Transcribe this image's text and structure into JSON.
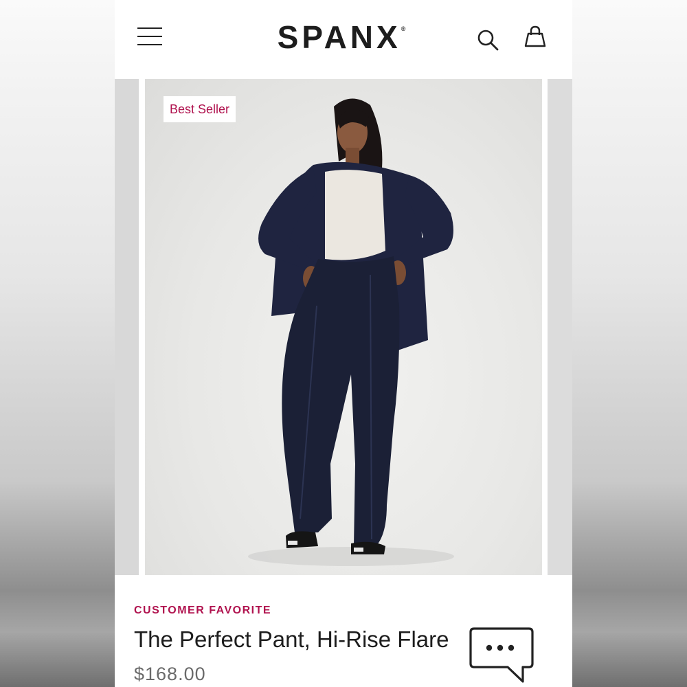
{
  "header": {
    "logo_text": "SPANX",
    "logo_mark": "®",
    "menu_icon": "hamburger-menu-icon",
    "search_icon": "search-icon",
    "bag_icon": "shopping-bag-icon"
  },
  "product": {
    "badge": "Best Seller",
    "eyebrow": "CUSTOMER FAVORITE",
    "name": "The Perfect Pant, Hi-Rise Flare",
    "price": "$168.00",
    "image_alt": "Model wearing navy blazer and navy flare pants"
  },
  "chat": {
    "icon": "chat-bubble-icon"
  },
  "colors": {
    "accent": "#b0124e",
    "text": "#1d1d1d",
    "price": "#6a6a6a",
    "navy": "#1f2440"
  }
}
